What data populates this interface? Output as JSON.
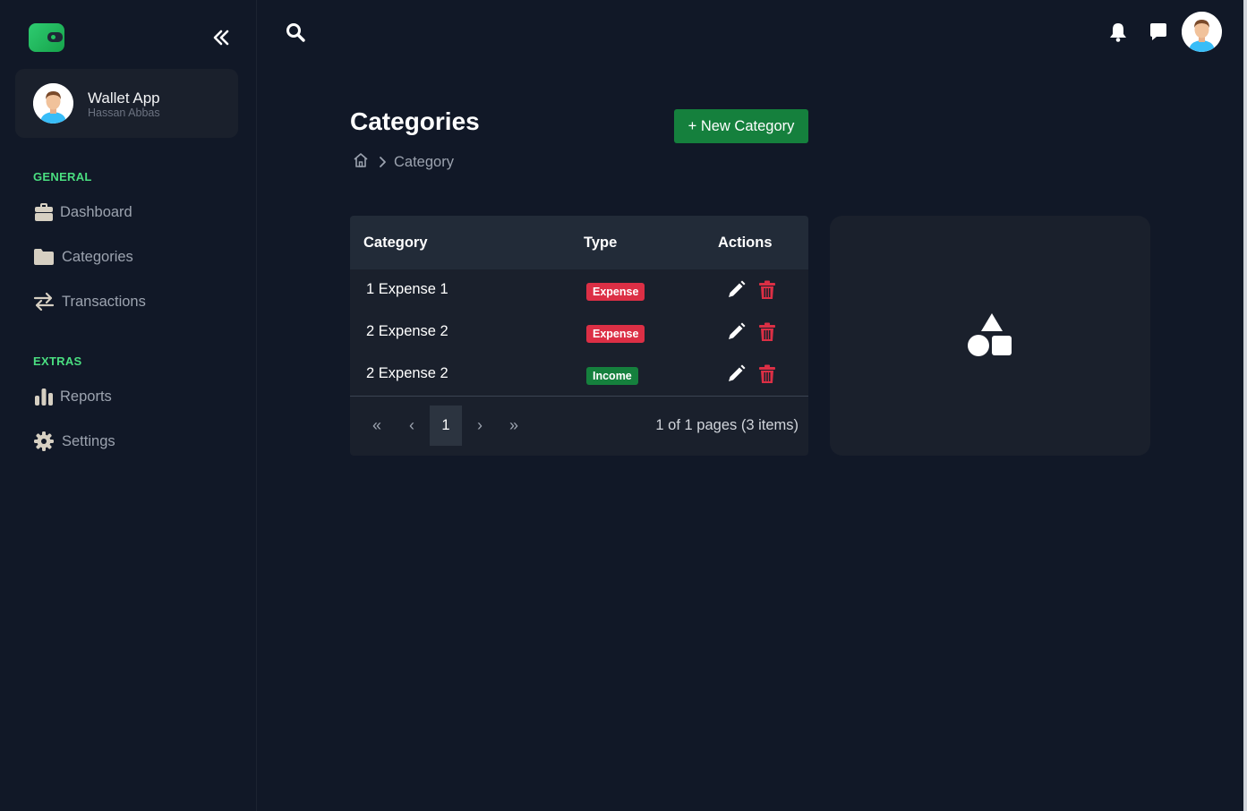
{
  "app": {
    "name": "Wallet App",
    "user": "Hassan Abbas"
  },
  "sidebar": {
    "sections": [
      {
        "label": "GENERAL",
        "items": [
          {
            "label": "Dashboard",
            "icon": "briefcase-icon"
          },
          {
            "label": "Categories",
            "icon": "folder-icon"
          },
          {
            "label": "Transactions",
            "icon": "transfer-arrows-icon"
          }
        ]
      },
      {
        "label": "EXTRAS",
        "items": [
          {
            "label": "Reports",
            "icon": "bar-chart-icon"
          },
          {
            "label": "Settings",
            "icon": "gear-icon"
          }
        ]
      }
    ]
  },
  "page": {
    "title": "Categories",
    "new_button": "+ New Category",
    "breadcrumb": [
      "Category"
    ]
  },
  "table": {
    "headers": [
      "Category",
      "Type",
      "Actions"
    ],
    "rows": [
      {
        "name": "1 Expense 1",
        "type": "Expense"
      },
      {
        "name": "2 Expense 2",
        "type": "Expense"
      },
      {
        "name": "2 Expense 2",
        "type": "Income"
      }
    ],
    "pagination": {
      "first": "«",
      "prev": "‹",
      "current": "1",
      "next": "›",
      "last": "»",
      "info": "1 of 1 pages (3 items)"
    }
  },
  "colors": {
    "background": "#111827",
    "card": "#1a202c",
    "accent_green": "#15803d",
    "section_label": "#4ade80",
    "expense_badge": "#dc2f45",
    "delete_icon": "#dc2f45"
  }
}
